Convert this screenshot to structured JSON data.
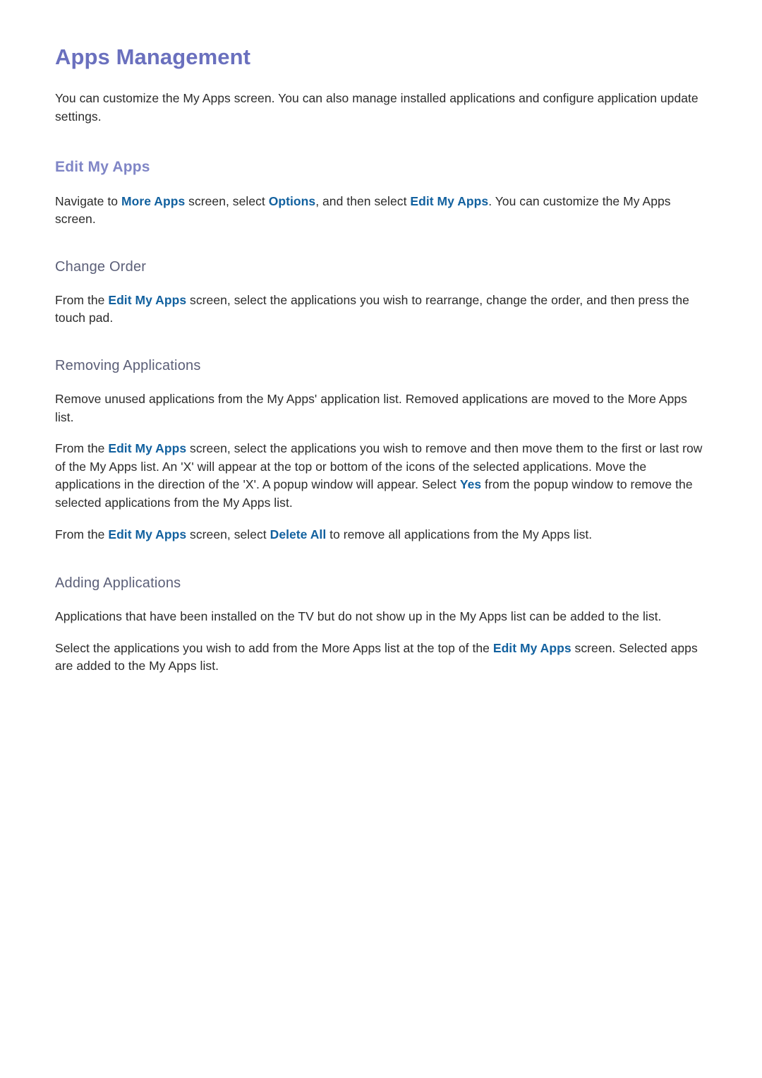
{
  "document": {
    "title": "Apps Management",
    "intro": "You can customize the My Apps screen. You can also manage installed applications and configure application update settings.",
    "colors": {
      "title": "#6a70be",
      "section_heading": "#7f85c6",
      "subsection_heading": "#5b5f78",
      "body_text": "#2b2b2b",
      "keyword_link": "#12619f",
      "page_background": "#ffffff"
    },
    "sections": [
      {
        "heading": "Edit My Apps",
        "paragraphs": [
          {
            "parts": [
              {
                "text": "Navigate to ",
                "style": "normal"
              },
              {
                "text": "More Apps",
                "style": "keyword"
              },
              {
                "text": " screen, select ",
                "style": "normal"
              },
              {
                "text": "Options",
                "style": "keyword"
              },
              {
                "text": ", and then select ",
                "style": "normal"
              },
              {
                "text": "Edit My Apps",
                "style": "keyword"
              },
              {
                "text": ". You can customize the My Apps screen.",
                "style": "normal"
              }
            ]
          }
        ],
        "subsections": [
          {
            "heading": "Change Order",
            "paragraphs": [
              {
                "parts": [
                  {
                    "text": "From the ",
                    "style": "normal"
                  },
                  {
                    "text": "Edit My Apps",
                    "style": "keyword"
                  },
                  {
                    "text": " screen, select the applications you wish to rearrange, change the order, and then press the touch pad.",
                    "style": "normal"
                  }
                ]
              }
            ]
          },
          {
            "heading": "Removing Applications",
            "paragraphs": [
              {
                "parts": [
                  {
                    "text": "Remove unused applications from the My Apps' application list. Removed applications are moved to the More Apps list.",
                    "style": "normal"
                  }
                ]
              },
              {
                "parts": [
                  {
                    "text": "From the ",
                    "style": "normal"
                  },
                  {
                    "text": "Edit My Apps",
                    "style": "keyword"
                  },
                  {
                    "text": " screen, select the applications you wish to remove and then move them to the first or last row of the My Apps list. An 'X' will appear at the top or bottom of the icons of the selected applications. Move the applications in the direction of the 'X'. A popup window will appear. Select ",
                    "style": "normal"
                  },
                  {
                    "text": "Yes",
                    "style": "keyword"
                  },
                  {
                    "text": " from the popup window to remove the selected applications from the My Apps list.",
                    "style": "normal"
                  }
                ]
              },
              {
                "parts": [
                  {
                    "text": "From the ",
                    "style": "normal"
                  },
                  {
                    "text": "Edit My Apps",
                    "style": "keyword"
                  },
                  {
                    "text": " screen, select ",
                    "style": "normal"
                  },
                  {
                    "text": "Delete All",
                    "style": "keyword"
                  },
                  {
                    "text": " to remove all applications from the My Apps list.",
                    "style": "normal"
                  }
                ]
              }
            ]
          },
          {
            "heading": "Adding Applications",
            "paragraphs": [
              {
                "parts": [
                  {
                    "text": "Applications that have been installed on the TV but do not show up in the My Apps list can be added to the list.",
                    "style": "normal"
                  }
                ]
              },
              {
                "parts": [
                  {
                    "text": "Select the applications you wish to add from the More Apps list at the top of the ",
                    "style": "normal"
                  },
                  {
                    "text": "Edit My Apps",
                    "style": "keyword"
                  },
                  {
                    "text": " screen. Selected apps are added to the My Apps list.",
                    "style": "normal"
                  }
                ]
              }
            ]
          }
        ]
      }
    ]
  }
}
